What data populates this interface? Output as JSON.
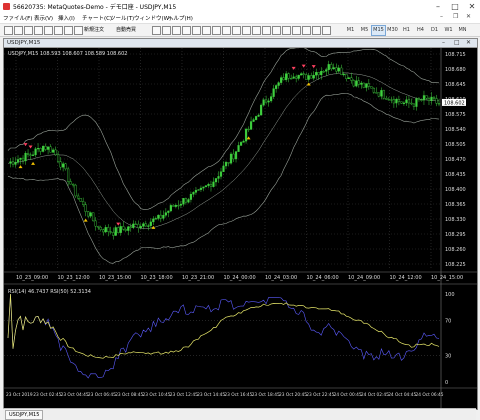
{
  "window": {
    "title": "56620735: MetaQuotes-Demo - デモ口座 - USDJPY,M15"
  },
  "menu": [
    "ファイル(F)",
    "表示(V)",
    "挿入(I)",
    "チャート(C)",
    "ツール(T)",
    "ウィンドウ(W)",
    "ヘルプ(H)"
  ],
  "toolbar": {
    "new_order": "新規注文",
    "auto_trading": "自動売買"
  },
  "timeframes": [
    "M1",
    "M5",
    "M15",
    "M30",
    "H1",
    "H4",
    "D1",
    "W1",
    "MN"
  ],
  "timeframe_selected": "M15",
  "chart": {
    "caption": "USDJPY,M15",
    "info": "USDJPY,M15  108.593 108.607 108.589 108.602",
    "current_price": "108.602",
    "price_labels": [
      "108.715",
      "108.680",
      "108.645",
      "108.610",
      "108.575",
      "108.540",
      "108.505",
      "108.470",
      "108.435",
      "108.400",
      "108.365",
      "108.330",
      "108.295",
      "108.260",
      "108.225"
    ],
    "time_labels": [
      "10_23_09:00",
      "10_23_12:00",
      "10_23_15:00",
      "10_23_18:00",
      "10_23_21:00",
      "10_24_00:00",
      "10_24_03:00",
      "10_24_06:00",
      "10_24_09:00",
      "10_24_12:00",
      "10_24_15:00"
    ],
    "rsi_info": "RSI(14) 46.7437  RSI(50) 52.3134",
    "rsi_levels": [
      "100",
      "70",
      "30",
      "0"
    ],
    "bottom_time_labels": [
      "23 Oct 2019",
      "23 Oct 02:45",
      "23 Oct 04:45",
      "23 Oct 06:45",
      "23 Oct 08:45",
      "23 Oct 10:45",
      "23 Oct 12:45",
      "23 Oct 14:45",
      "23 Oct 16:45",
      "23 Oct 18:45",
      "23 Oct 20:45",
      "23 Oct 22:45",
      "24 Oct 00:45",
      "24 Oct 02:45",
      "24 Oct 04:45",
      "24 Oct 06:45"
    ],
    "colors": {
      "bull": "#3fd13f",
      "bear": "#000000",
      "candle_outline": "#3fd13f",
      "bands": "#9aa39a",
      "grid": "#3a3a3a",
      "rsi14": "#5c5cff",
      "rsi50": "#e8e86a",
      "up_arrow": "#f0c000",
      "down_arrow": "#ff4060"
    }
  },
  "tabs": [
    "USDJPY,M15"
  ]
}
